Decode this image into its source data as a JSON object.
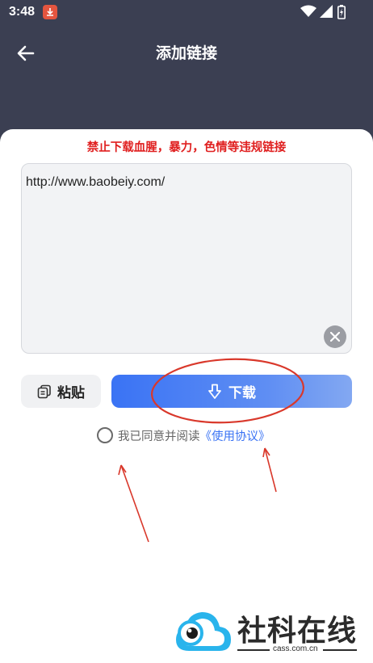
{
  "status_bar": {
    "time": "3:48"
  },
  "header": {
    "title": "添加链接"
  },
  "warning": "禁止下载血腥，暴力，色情等违规链接",
  "link_input": {
    "value": "http://www.baobeiy.com/"
  },
  "actions": {
    "paste_label": "粘贴",
    "download_label": "下载"
  },
  "agreement": {
    "text": "我已同意并阅读",
    "link": "《使用协议》",
    "checked": false
  },
  "watermark": {
    "title": "社科在线",
    "domain": "cass.com.cn"
  },
  "colors": {
    "header_bg": "#3b3f52",
    "accent": "#3a73f4",
    "warning": "#e02020",
    "annotation": "#d9382b"
  }
}
